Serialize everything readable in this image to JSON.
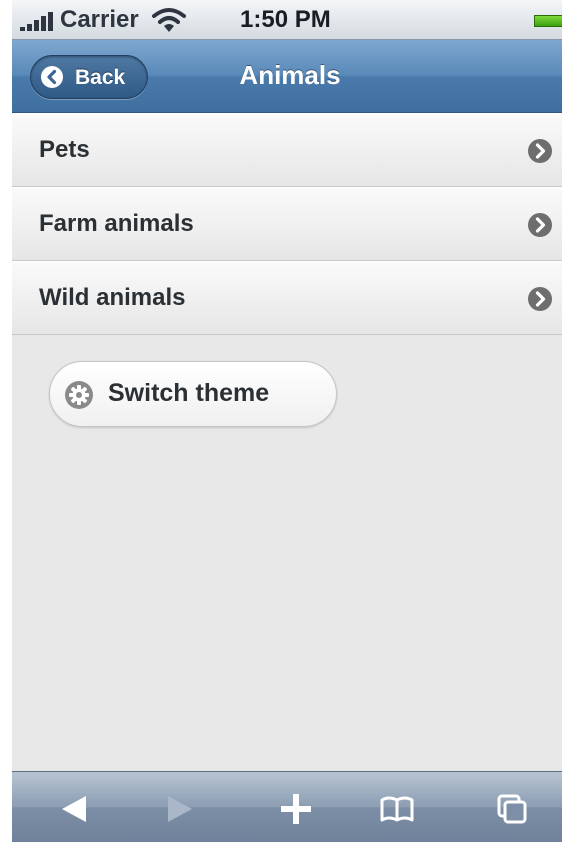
{
  "status_bar": {
    "carrier": "Carrier",
    "time": "1:50 PM",
    "signal_icon": "signal-bars-icon",
    "wifi_icon": "wifi-icon",
    "battery_icon": "battery-icon"
  },
  "header": {
    "back_label": "Back",
    "title": "Animals",
    "back_icon": "chevron-left-circle-icon",
    "color": "#5a8ab9"
  },
  "menu": {
    "items": [
      {
        "label": "Pets",
        "icon": "chevron-right-circle-icon"
      },
      {
        "label": "Farm animals",
        "icon": "chevron-right-circle-icon"
      },
      {
        "label": "Wild animals",
        "icon": "chevron-right-circle-icon"
      }
    ]
  },
  "theme_button": {
    "label": "Switch theme",
    "icon": "gear-icon"
  },
  "toolbar": {
    "icons": [
      "back-arrow-icon",
      "forward-arrow-icon",
      "plus-icon",
      "book-icon",
      "pages-icon"
    ]
  }
}
